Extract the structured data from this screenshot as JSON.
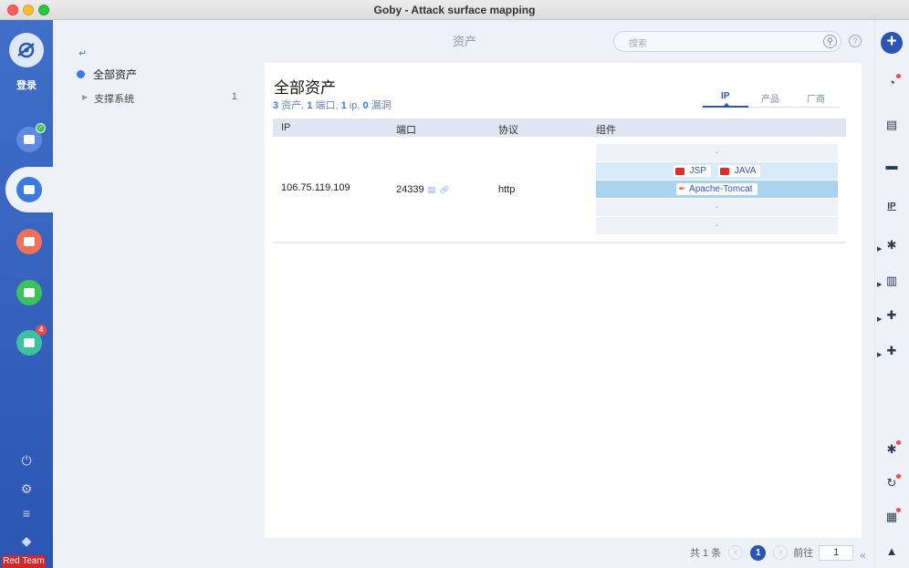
{
  "window": {
    "title": "Goby - Attack surface mapping"
  },
  "sidebar": {
    "login_label": "登录",
    "nav": [
      {
        "name": "scan",
        "color": "#5c8be0",
        "icon": "scan-icon",
        "badge_check": true
      },
      {
        "name": "assets",
        "color": "#3a7be0",
        "icon": "assets-icon",
        "active": true
      },
      {
        "name": "web",
        "color": "#f27058",
        "icon": "web-icon"
      },
      {
        "name": "report",
        "color": "#3cc25a",
        "icon": "report-icon"
      },
      {
        "name": "plugins",
        "color": "#3cc2a0",
        "icon": "puzzle-icon",
        "badge": "4"
      }
    ],
    "team_label": "Red Team"
  },
  "tree": {
    "root_label": "全部资产",
    "children": [
      {
        "label": "支撑系统",
        "count": "1"
      }
    ]
  },
  "header": {
    "page_title": "资产",
    "search_placeholder": "搜索"
  },
  "card": {
    "title": "全部资产",
    "stats": {
      "assets": "3",
      "assets_label": " 资产, ",
      "ports": "1",
      "ports_label": " 端口, ",
      "ips": "1",
      "ips_label": " ip, ",
      "vulns": "0",
      "vulns_label": " 漏洞"
    },
    "tabs": [
      "IP",
      "产品",
      "厂商"
    ],
    "columns": [
      "IP",
      "端口",
      "协议",
      "组件"
    ],
    "rows": [
      {
        "ip": "106.75.119.109",
        "port": "24339",
        "protocol": "http",
        "components": [
          {
            "type": "empty",
            "text": "-"
          },
          {
            "type": "chips",
            "chips": [
              "JSP",
              "JAVA"
            ]
          },
          {
            "type": "chips",
            "chips": [
              "Apache-Tomcat"
            ]
          },
          {
            "type": "empty",
            "text": "-"
          },
          {
            "type": "empty",
            "text": "-"
          }
        ]
      }
    ]
  },
  "pager": {
    "total_label": "共 1 条",
    "current_page": "1",
    "go_label": "前往",
    "input_value": "1"
  },
  "right_sidebar": {
    "icons": [
      "clock-icon",
      "document-icon",
      "monitor-icon",
      "ip-icon",
      "bug-icon",
      "chart-icon",
      "puzzle-icon",
      "plugins-icon",
      "bug-alert-icon",
      "refresh-icon",
      "file-chart-icon",
      "warning-icon"
    ]
  }
}
